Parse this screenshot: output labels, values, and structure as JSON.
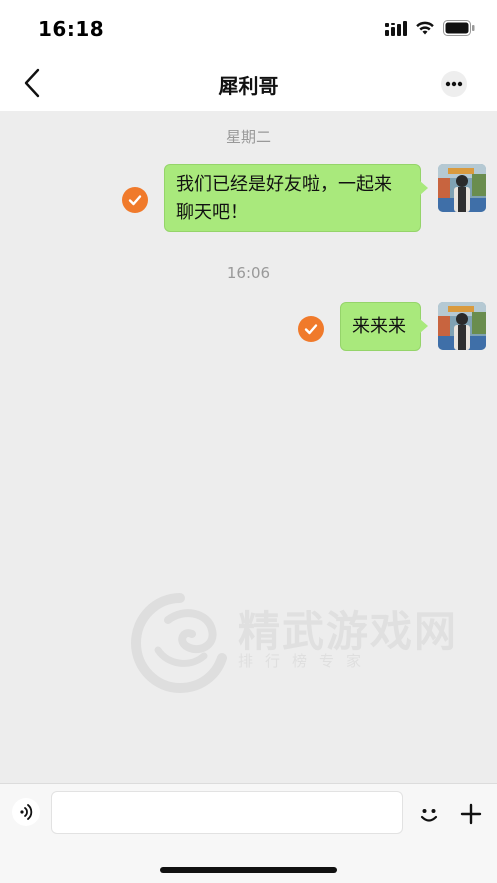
{
  "status_bar": {
    "time": "16:18"
  },
  "nav": {
    "title": "犀利哥"
  },
  "messages": [
    {
      "time_label": "星期二",
      "text_line1": "我们已经是好友啦，一起来",
      "text_line2": "聊天吧！"
    },
    {
      "time_label": "16:06",
      "text": "来来来"
    }
  ],
  "watermark": {
    "main": "精武游戏网",
    "sub": "排行榜专家"
  },
  "colors": {
    "bubble": "#a9e97c",
    "check": "#f07a2b",
    "chat_bg": "#ededed"
  },
  "input": {
    "value": "",
    "placeholder": ""
  }
}
